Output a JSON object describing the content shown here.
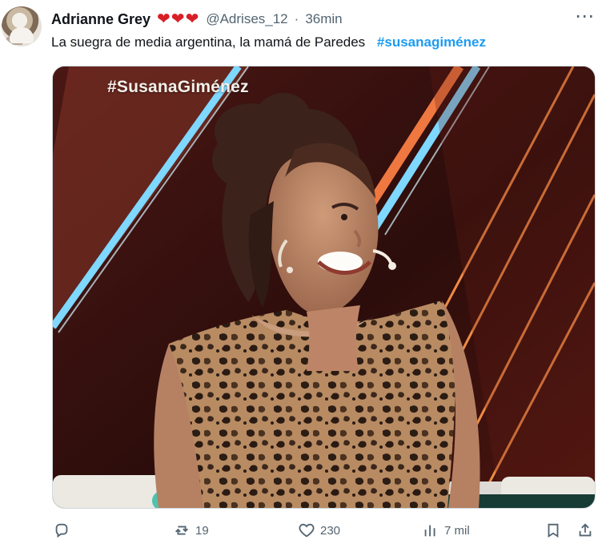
{
  "tweet": {
    "author": "Adrianne Grey",
    "hearts": "❤❤❤",
    "handle": "@Adrises_12",
    "separator": "·",
    "time": "36min",
    "text": "La suegra de media argentina,  la mamá de Paredes",
    "hashtag": "#susanagiménez"
  },
  "media": {
    "watermark": "#SusanaGiménez"
  },
  "actions": {
    "reply_count": "",
    "retweet_count": "19",
    "like_count": "230",
    "views_count": "7 mil"
  },
  "icons": {
    "more": "more-icon",
    "reply": "reply-icon",
    "retweet": "retweet-icon",
    "like": "heart-icon",
    "views": "views-icon",
    "bookmark": "bookmark-icon",
    "share": "share-icon"
  },
  "colors": {
    "accent": "#1d9bf0",
    "heart": "#d91f26",
    "muted": "#536471"
  }
}
